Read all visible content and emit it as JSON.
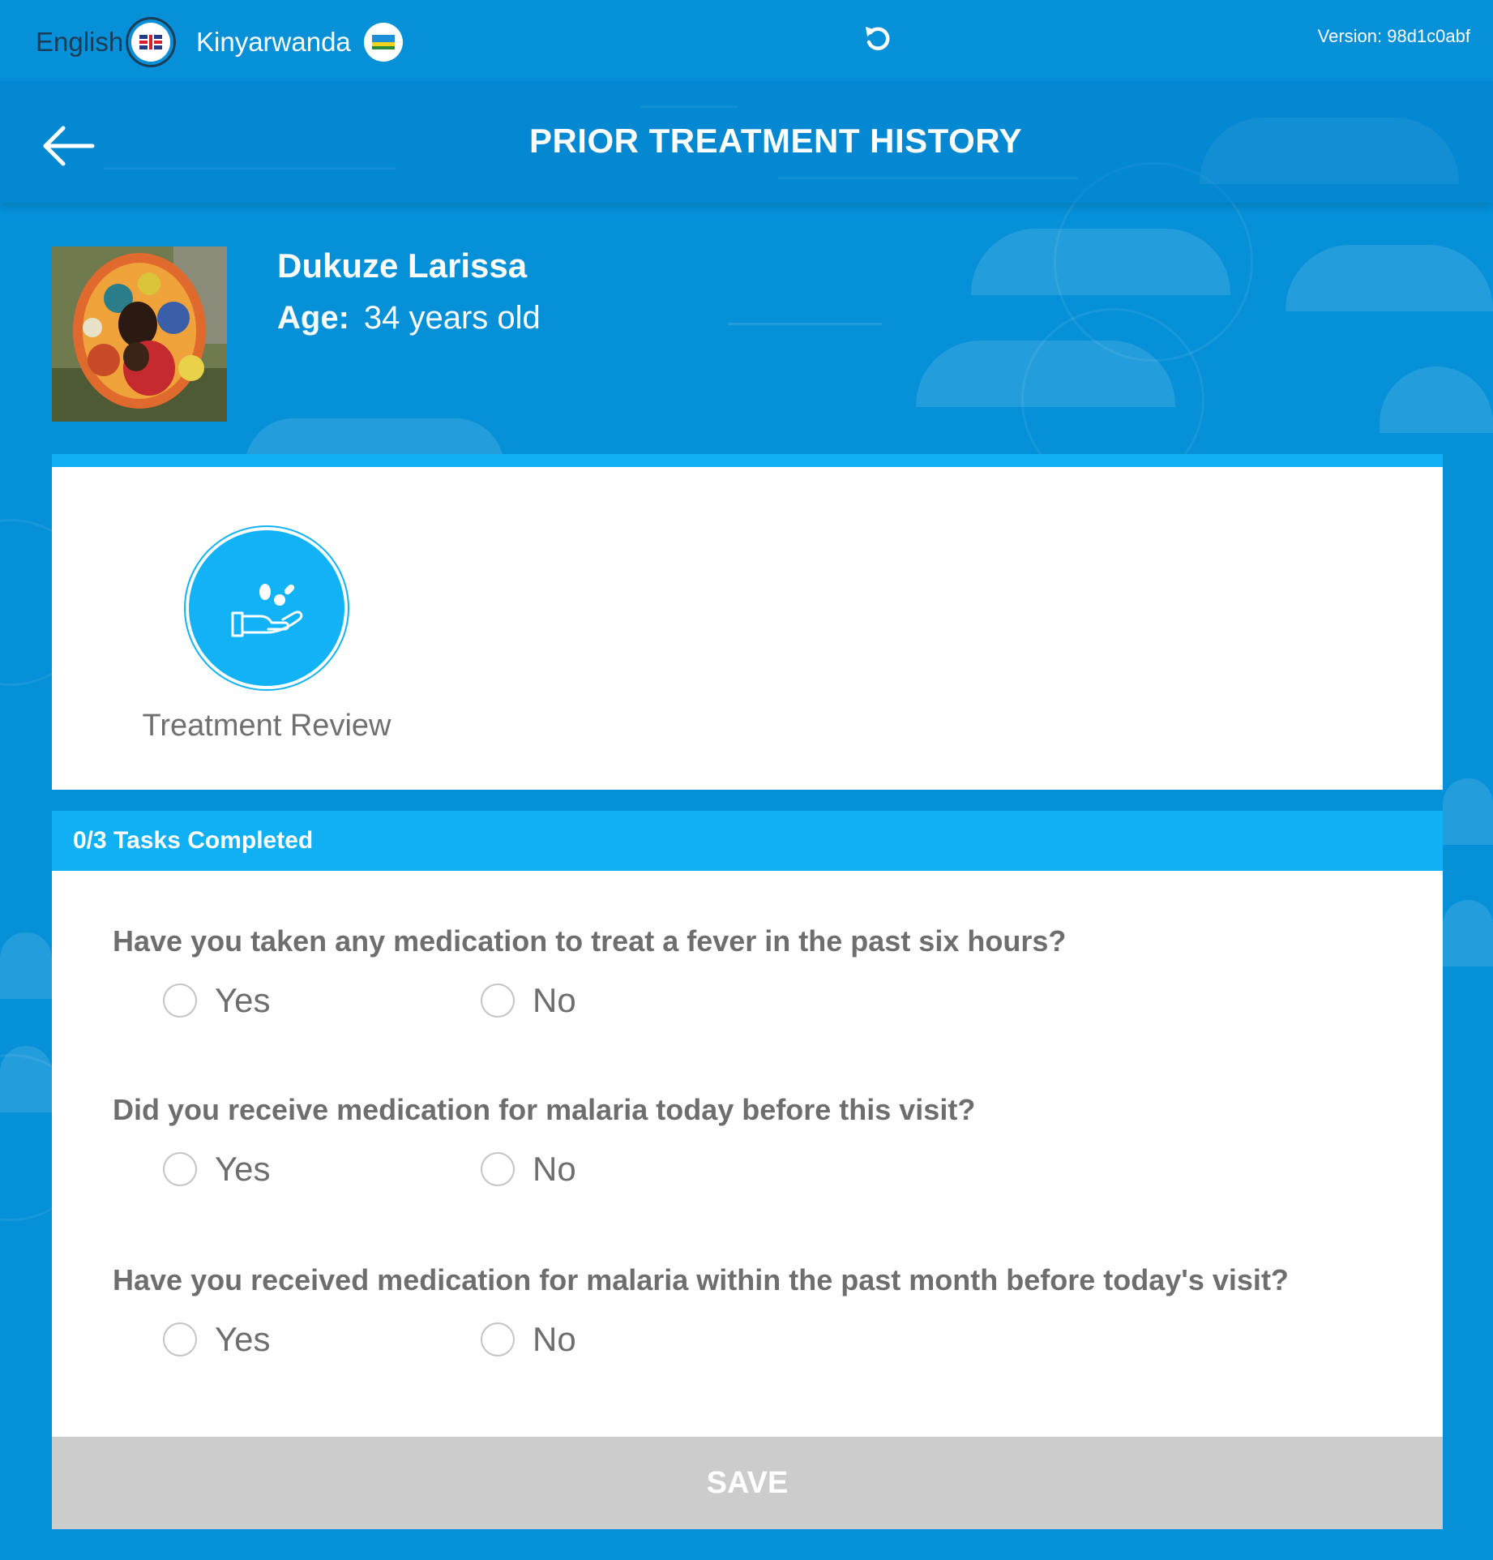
{
  "colors": {
    "background": "#0590d8",
    "accent": "#10b0f5",
    "card": "#ffffff",
    "save_disabled": "#cccccc",
    "question_text": "#6e6e6e"
  },
  "topbar": {
    "languages": [
      {
        "label": "English",
        "flag_icon": "uk-flag-icon",
        "selected": true
      },
      {
        "label": "Kinyarwanda",
        "flag_icon": "rwanda-flag-icon",
        "selected": false
      }
    ],
    "refresh_icon": "refresh-icon",
    "version": "Version: 98d1c0abf"
  },
  "header": {
    "back_icon": "arrow-left-icon",
    "title": "PRIOR TREATMENT HISTORY"
  },
  "patient": {
    "name": "Dukuze Larissa",
    "age_label": "Age:",
    "age_value": "34 years old"
  },
  "section": {
    "icon": "hand-pills-icon",
    "label": "Treatment Review"
  },
  "tasks": {
    "progress": "0/3 Tasks Completed",
    "questions": [
      {
        "text": "Have you taken any medication to treat a fever in the past six hours?",
        "options": [
          "Yes",
          "No"
        ]
      },
      {
        "text": "Did you receive medication for malaria today before this visit?",
        "options": [
          "Yes",
          "No"
        ]
      },
      {
        "text": "Have you received medication for malaria within the past month before today's visit?",
        "options": [
          "Yes",
          "No"
        ]
      }
    ],
    "save_label": "SAVE"
  }
}
